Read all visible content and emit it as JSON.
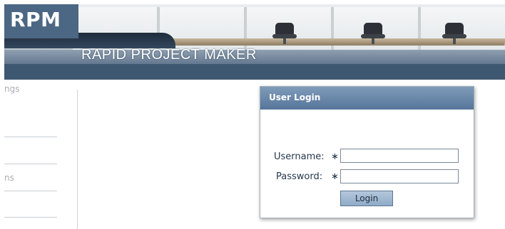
{
  "header": {
    "logo": "RPM",
    "tagline": "RAPID PROJECT MAKER"
  },
  "sidebar": {
    "fragments": [
      "ngs",
      "ns"
    ]
  },
  "login": {
    "title": "User Login",
    "username_label": "Username:",
    "password_label": "Password:",
    "required_marker": "∗",
    "username_value": "",
    "password_value": "",
    "button_label": "Login"
  }
}
